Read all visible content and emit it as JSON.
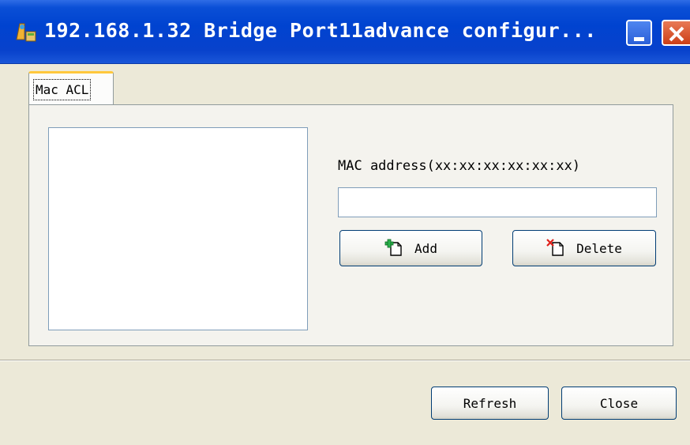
{
  "window": {
    "title": "192.168.1.32 Bridge Port11advance configur...",
    "icons": {
      "app": "app-icon",
      "minimize": "minimize-icon",
      "close": "close-icon"
    }
  },
  "tabs": [
    {
      "label": "Mac ACL",
      "selected": true
    }
  ],
  "mac_acl": {
    "mac_label": "MAC address(xx:xx:xx:xx:xx:xx)",
    "mac_value": "",
    "add_label": "Add",
    "add_icon": "add-document-icon",
    "delete_label": "Delete",
    "delete_icon": "delete-document-icon",
    "list_items": []
  },
  "footer": {
    "refresh_label": "Refresh",
    "close_label": "Close"
  }
}
